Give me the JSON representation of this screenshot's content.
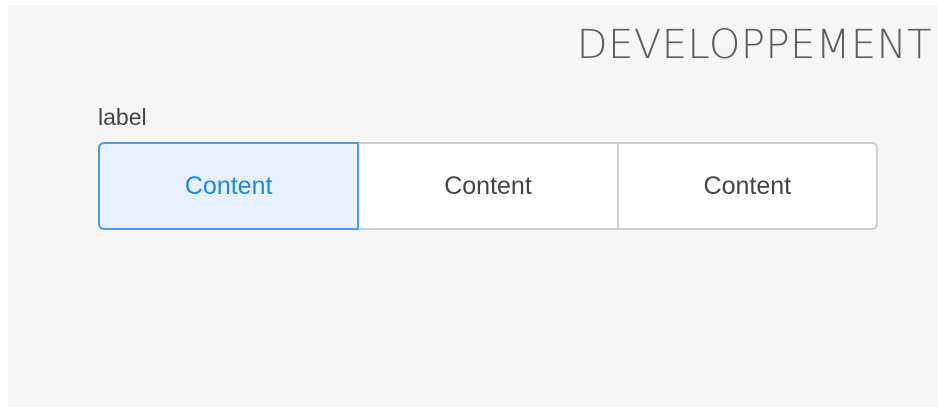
{
  "header": {
    "environment_tag": "DEVELOPPEMENT"
  },
  "form": {
    "field_label": "label",
    "segmented_control": {
      "options": [
        {
          "label": "Content",
          "selected": true
        },
        {
          "label": "Content",
          "selected": false
        },
        {
          "label": "Content",
          "selected": false
        }
      ],
      "selected_index": 0
    }
  },
  "colors": {
    "panel_background": "#f6f6f6",
    "selected_background": "#e6f1fd",
    "selected_text": "#1e88e5",
    "selected_border": "#4a9fe8",
    "border": "#cfcfcf",
    "text": "#454545",
    "env_tag_text": "#5a5e63"
  }
}
